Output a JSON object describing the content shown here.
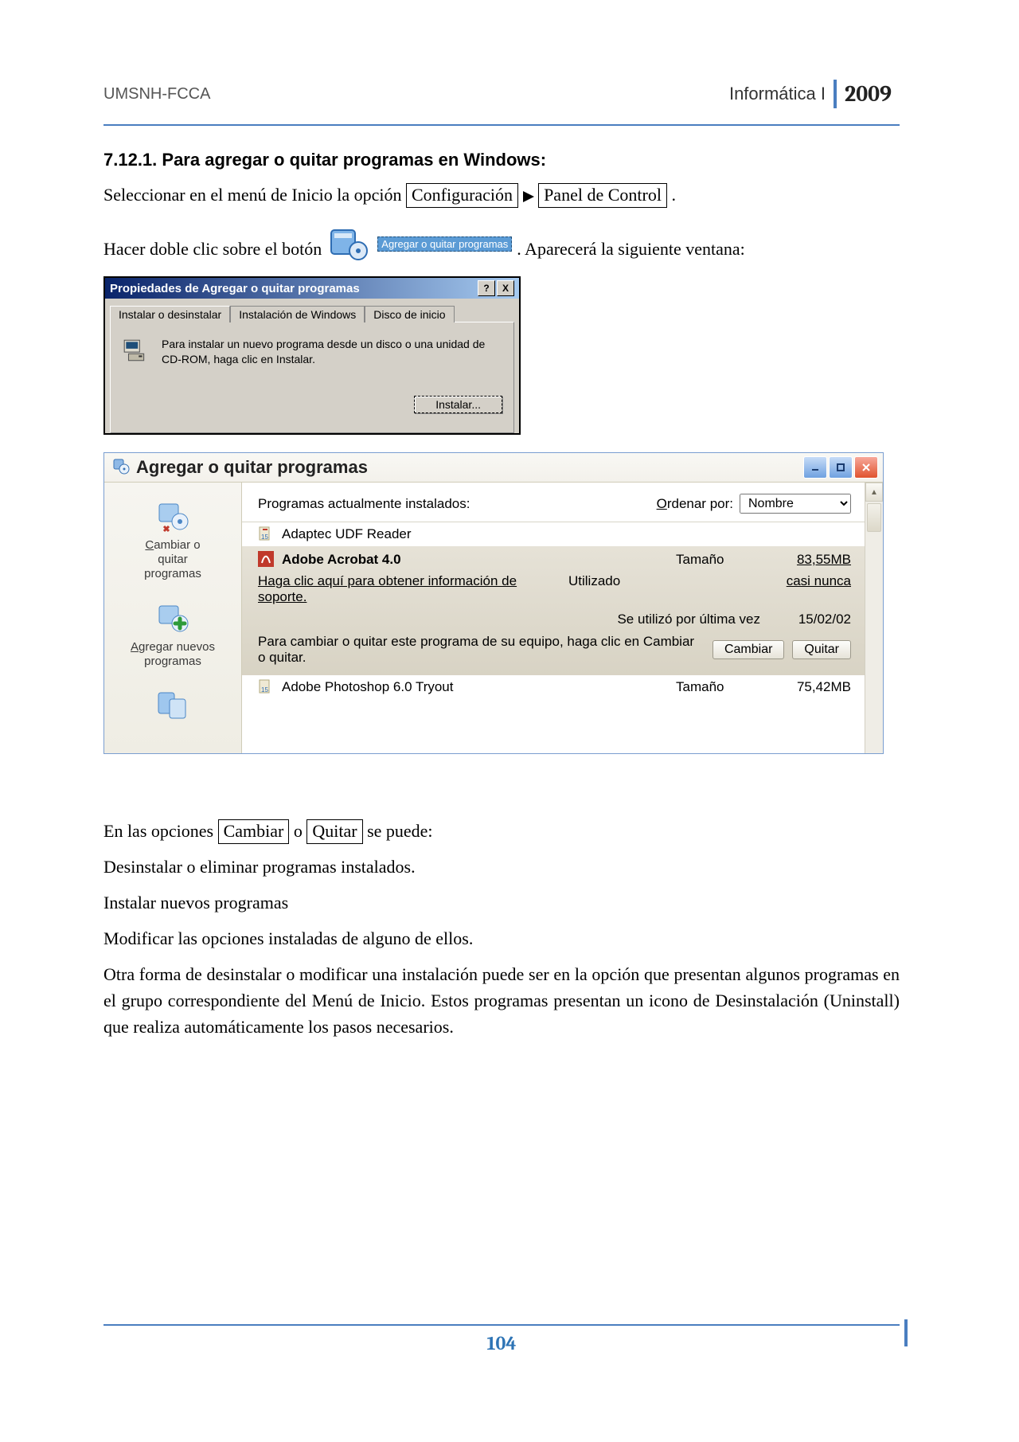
{
  "header": {
    "left": "UMSNH-FCCA",
    "course": "Informática I",
    "year": "2009"
  },
  "section_title": "7.12.1. Para agregar o quitar programas en Windows:",
  "line1_pre": "Seleccionar en el menú de Inicio la opción ",
  "box_config": "Configuración",
  "box_panel": "Panel de Control",
  "period": ".",
  "line2_pre": "Hacer doble clic sobre el botón",
  "cp_tooltip": "Agregar o quitar programas",
  "line2_post": ". Aparecerá la siguiente ventana:",
  "win98": {
    "title": "Propiedades de Agregar o quitar programas",
    "help": "?",
    "close": "X",
    "tabs": [
      "Instalar o desinstalar",
      "Instalación de Windows",
      "Disco de inicio"
    ],
    "panel_text": "Para instalar un nuevo programa desde un disco o una unidad de CD-ROM, haga clic en Instalar.",
    "install_btn": "Instalar..."
  },
  "xp": {
    "title": "Agregar o quitar programas",
    "side": {
      "change": "Cambiar o quitar programas",
      "add": "Agregar nuevos programas",
      "change_u": "C",
      "add_u": "A"
    },
    "toprow": {
      "label": "Programas actualmente instalados:",
      "sort_label": "Ordenar por:",
      "sort_value": "Nombre",
      "sort_u": "O"
    },
    "rows": {
      "r1": "Adaptec UDF Reader",
      "sel_name": "Adobe Acrobat 4.0",
      "sel_size_lbl": "Tamaño",
      "sel_size_val": "83,55MB",
      "support": "Haga clic aquí para obtener información de soporte.",
      "used_lbl": "Utilizado",
      "used_val": "casi nunca",
      "last_lbl": "Se utilizó por última vez",
      "last_val": "15/02/02",
      "change_txt": "Para cambiar o quitar este programa de su equipo, haga clic en Cambiar o quitar.",
      "btn_change": "Cambiar",
      "btn_remove": "Quitar",
      "r3": "Adobe Photoshop 6.0 Tryout",
      "r3_size_lbl": "Tamaño",
      "r3_size_val": "75,42MB"
    }
  },
  "after1_pre": "En las opciones ",
  "box_cambiar": "Cambiar",
  "after1_mid": " o ",
  "box_quitar": "Quitar",
  "after1_post": " se puede:",
  "after2": "Desinstalar o eliminar programas instalados.",
  "after3": "Instalar nuevos programas",
  "after4": "Modificar las opciones instaladas de alguno de ellos.",
  "after5": "Otra forma de desinstalar o modificar una instalación puede ser en la opción que presentan algunos programas en el grupo correspondiente del Menú de Inicio. Estos programas presentan un icono de Desinstalación (Uninstall) que realiza automáticamente los pasos necesarios.",
  "footer": {
    "page": "104"
  }
}
